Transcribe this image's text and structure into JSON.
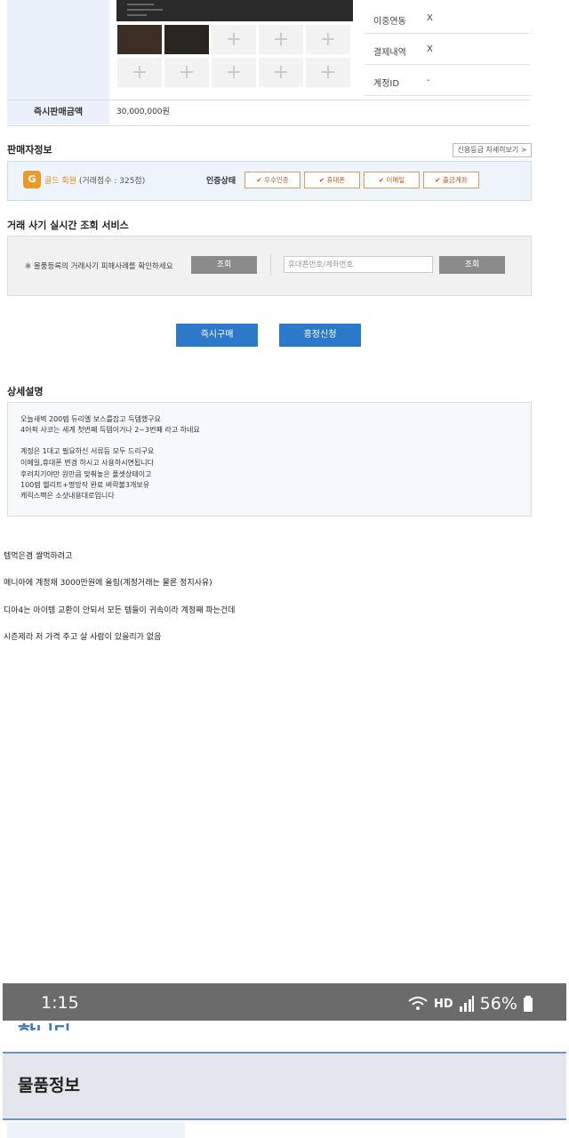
{
  "product": {
    "info_rows": [
      {
        "key": "이중연동",
        "value": "X"
      },
      {
        "key": "결제내역",
        "value": "X"
      },
      {
        "key": "계정ID",
        "value": "-"
      }
    ],
    "thumb_plus": "+"
  },
  "price": {
    "label": "즉시판매금액",
    "value": "30,000,000원"
  },
  "seller": {
    "title": "판매자정보",
    "detail_button": "신용등급 자세히보기 >",
    "grade_icon": "G",
    "grade": "골드 회원",
    "score": "(거래점수 : 325점)",
    "cert_label": "인증상태",
    "certs": [
      "✔ 우수인증",
      "✔ 휴대폰",
      "✔ 이메일",
      "✔ 출금계좌"
    ]
  },
  "fraud": {
    "title": "거래 사기 실시간 조회 서비스",
    "note": "※ 물품등록의 거래사기 피해사례를 확인하세요",
    "lookup1": "조회",
    "input_placeholder": "휴대폰번호/계좌번호",
    "lookup2": "조회"
  },
  "actions": {
    "buy": "즉시구매",
    "negotiate": "흥정신청"
  },
  "description": {
    "title": "상세설명",
    "lines": [
      "오늘새벽 200렙 듀리엘 보스를잡고 득템했구요",
      "4어픽 샤코는 세계 첫번째 득템이거나 2~3번째 라고 하네요",
      "",
      "계정은 1대고 필요하신 서류등 모두 드리구요",
      "이메일,휴대폰 변경 하시고 사용하시면됩니다",
      "후려치기야만 원만큼 맞춰놓은 풀셋상태이고",
      "100렙 헬리트+명망작 완료 벼락불3개보유",
      "캐릭스펙은 소샷내용대로입니다"
    ]
  },
  "post": {
    "lines": [
      "템먹은겸 쌀먹하려고",
      "매니아에 계정채 3000만원에 올림(계정거래는 물론 정지사유)",
      "디아4는 아이템 교환이 안되서 모든 템들이 귀속이라 계정째 파는건데",
      "시즌제라 저 가격 주고 살 사람이 있을리가 없음"
    ]
  },
  "statusbar": {
    "time": "1:15",
    "hd": "HD",
    "battery": "56%"
  },
  "bottom": {
    "partial_text": "합니다",
    "goods_title": "물품정보"
  }
}
